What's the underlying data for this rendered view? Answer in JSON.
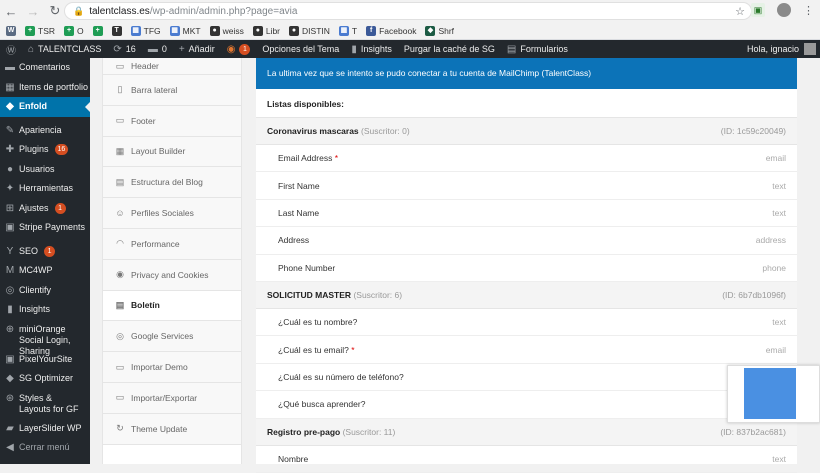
{
  "browser": {
    "url_host": "talentclass.es",
    "url_path": "/wp-admin/admin.php?page=avia",
    "bookmarks": [
      {
        "label": "",
        "icon": "wordpress-icon",
        "color": "#5b6b82"
      },
      {
        "label": "TSR",
        "icon": "green-plus-icon",
        "color": "#1f9d55"
      },
      {
        "label": "O",
        "icon": "green-plus-icon",
        "color": "#1f9d55"
      },
      {
        "label": "",
        "icon": "green-plus-icon",
        "color": "#1f9d55"
      },
      {
        "label": "",
        "icon": "t-icon",
        "color": "#333333"
      },
      {
        "label": "TFG",
        "icon": "doc-icon",
        "color": "#4a7bd0"
      },
      {
        "label": "MKT",
        "icon": "doc-icon",
        "color": "#4a7bd0"
      },
      {
        "label": "weiss",
        "icon": "globe-icon",
        "color": "#333333"
      },
      {
        "label": "Libr",
        "icon": "globe-icon",
        "color": "#333333"
      },
      {
        "label": "DISTIN",
        "icon": "globe-icon",
        "color": "#333333"
      },
      {
        "label": "T",
        "icon": "doc-icon",
        "color": "#4a7bd0"
      },
      {
        "label": "Facebook",
        "icon": "facebook-icon",
        "color": "#3b5998"
      },
      {
        "label": "Shrf",
        "icon": "shield-icon",
        "color": "#1c5b44"
      }
    ]
  },
  "adminbar": {
    "site": "TALENTCLASS",
    "updates": "16",
    "comments": "0",
    "add_new": "Añadir",
    "badge": "1",
    "theme_options": "Opciones del Tema",
    "insights": "Insights",
    "purge": "Purgar la caché de SG",
    "forms": "Formularios",
    "greeting": "Hola, ignacio"
  },
  "sidebar": {
    "items": [
      {
        "label": "Comentarios",
        "icon": "comment-icon"
      },
      {
        "label": "Items de portfolio",
        "icon": "portfolio-icon"
      },
      {
        "label": "Enfold",
        "icon": "enfold-icon",
        "active": true
      },
      {
        "label": "Apariencia",
        "icon": "brush-icon",
        "sep": true
      },
      {
        "label": "Plugins",
        "icon": "plugin-icon",
        "badge": "16"
      },
      {
        "label": "Usuarios",
        "icon": "user-icon"
      },
      {
        "label": "Herramientas",
        "icon": "wrench-icon"
      },
      {
        "label": "Ajustes",
        "icon": "settings-icon",
        "badge": "1"
      },
      {
        "label": "Stripe Payments",
        "icon": "stripe-icon"
      },
      {
        "label": "SEO",
        "icon": "seo-icon",
        "badge": "1",
        "sep": true
      },
      {
        "label": "MC4WP",
        "icon": "mc4wp-icon"
      },
      {
        "label": "Clientify",
        "icon": "clientify-icon"
      },
      {
        "label": "Insights",
        "icon": "insights-icon"
      },
      {
        "label": "miniOrange Social Login, Sharing",
        "icon": "miniorange-icon",
        "two": true
      },
      {
        "label": "PixelYourSite",
        "icon": "pixel-icon"
      },
      {
        "label": "SG Optimizer",
        "icon": "sg-icon"
      },
      {
        "label": "Styles & Layouts for GF",
        "icon": "styles-icon",
        "two": true
      },
      {
        "label": "LayerSlider WP",
        "icon": "layers-icon"
      },
      {
        "label": "Cerrar menú",
        "icon": "collapse-icon",
        "collapse": true
      }
    ]
  },
  "avia_menu": {
    "items": [
      {
        "label": "Header",
        "icon": "header-icon"
      },
      {
        "label": "Barra lateral",
        "icon": "sidebar-icon"
      },
      {
        "label": "Footer",
        "icon": "footer-icon"
      },
      {
        "label": "Layout Builder",
        "icon": "layout-icon"
      },
      {
        "label": "Estructura del Blog",
        "icon": "blog-icon"
      },
      {
        "label": "Perfiles Sociales",
        "icon": "social-icon"
      },
      {
        "label": "Performance",
        "icon": "gauge-icon"
      },
      {
        "label": "Privacy and Cookies",
        "icon": "cookie-icon"
      },
      {
        "label": "Boletín",
        "icon": "newsletter-icon",
        "active": true
      },
      {
        "label": "Google Services",
        "icon": "google-icon"
      },
      {
        "label": "Importar Demo",
        "icon": "import-icon"
      },
      {
        "label": "Importar/Exportar",
        "icon": "export-icon"
      },
      {
        "label": "Theme Update",
        "icon": "update-icon"
      }
    ]
  },
  "panel": {
    "notice": "La ultima vez que se intento se pudo conectar a tu cuenta de MailChimp (TalentClass)",
    "listas_label": "Listas disponibles:",
    "lists": [
      {
        "name": "Coronavirus mascaras",
        "subscribers": "(Suscritor: 0)",
        "id": "(ID: 1c59c20049)",
        "fields": [
          {
            "label": "Email Address",
            "type": "email",
            "required": true
          },
          {
            "label": "First Name",
            "type": "text"
          },
          {
            "label": "Last Name",
            "type": "text"
          },
          {
            "label": "Address",
            "type": "address"
          },
          {
            "label": "Phone Number",
            "type": "phone"
          }
        ]
      },
      {
        "name": "SOLICITUD MASTER",
        "subscribers": "(Suscritor: 6)",
        "id": "(ID: 6b7db1096f)",
        "fields": [
          {
            "label": "¿Cuál es tu nombre?",
            "type": "text"
          },
          {
            "label": "¿Cuál es tu email?",
            "type": "email",
            "required": true
          },
          {
            "label": "¿Cuál es su número de teléfono?",
            "type": ""
          },
          {
            "label": "¿Qué busca aprender?",
            "type": ""
          }
        ]
      },
      {
        "name": "Registro pre-pago",
        "subscribers": "(Suscritor: 11)",
        "id": "(ID: 837b2ac681)",
        "fields": [
          {
            "label": "Nombre",
            "type": "text"
          }
        ]
      }
    ]
  },
  "colors": {
    "admin_dark": "#23282d",
    "accent": "#0073aa",
    "notice": "#0c73b8",
    "badge": "#d54e21"
  }
}
